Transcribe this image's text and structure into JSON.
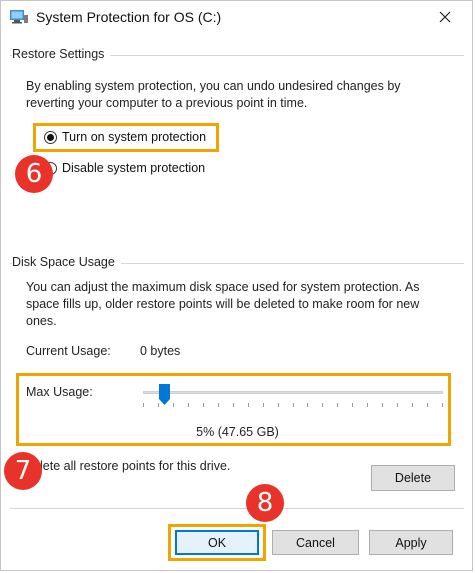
{
  "window": {
    "title": "System Protection for OS (C:)",
    "icon": "system-protection-icon"
  },
  "restore_settings": {
    "group_label": "Restore Settings",
    "description_line1": "By enabling system protection, you can undo undesired changes by",
    "description_line2": "reverting your computer to a previous point in time.",
    "options": [
      {
        "label": "Turn on system protection",
        "selected": true
      },
      {
        "label": "Disable system protection",
        "selected": false
      }
    ]
  },
  "disk_space": {
    "group_label": "Disk Space Usage",
    "description_line1": "You can adjust the maximum disk space used for system protection. As",
    "description_line2": "space fills up, older restore points will be deleted to make room for new",
    "description_line3": "ones.",
    "current_usage_label": "Current Usage:",
    "current_usage_value": "0 bytes",
    "max_usage_label": "Max Usage:",
    "max_usage_percent": 5,
    "max_usage_readout": "5% (47.65 GB)",
    "delete_text": "lete all restore points for this drive.",
    "delete_button": "Delete"
  },
  "buttons": {
    "ok": "OK",
    "cancel": "Cancel",
    "apply": "Apply"
  },
  "annotations": {
    "step6": "6",
    "step7": "7",
    "step8": "8",
    "highlight_color": "#f0a500",
    "badge_color": "#e8322a"
  },
  "colors": {
    "accent": "#0078d7",
    "slider_thumb": "#0078d7"
  }
}
